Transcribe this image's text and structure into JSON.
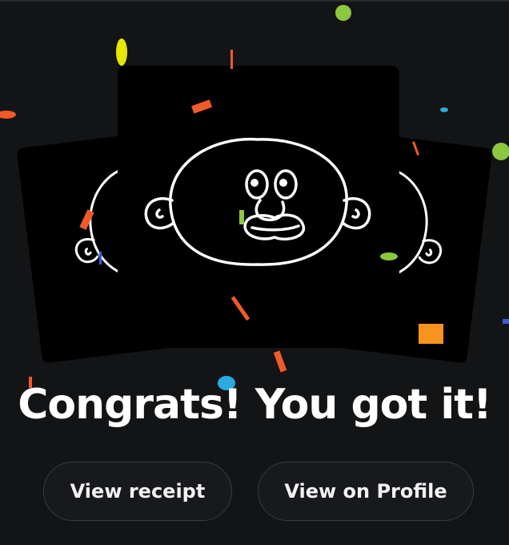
{
  "headline": "Congrats! You got it!",
  "actions": {
    "view_receipt_label": "View receipt",
    "view_profile_label": "View on Profile"
  },
  "colors": {
    "background": "#131416",
    "card": "#000000",
    "text": "#ffffff",
    "button_border": "#3a3b3f"
  },
  "confetti_colors": [
    "#f05a28",
    "#8dc63f",
    "#e6e600",
    "#29abe2",
    "#f7931e",
    "#3b5bdb"
  ]
}
